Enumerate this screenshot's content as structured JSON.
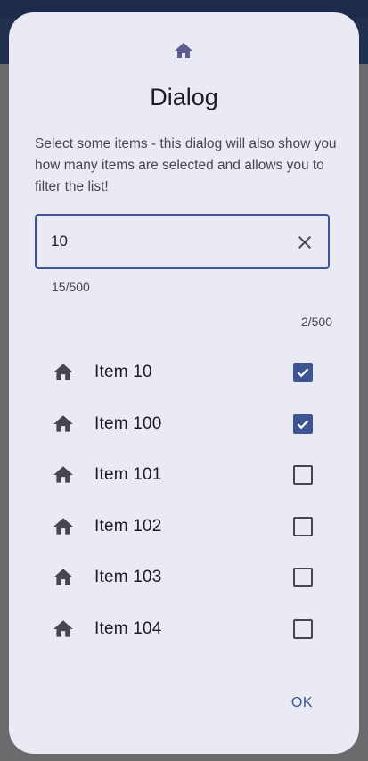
{
  "dialog": {
    "icon": "home-icon",
    "title": "Dialog",
    "description": "Select some items - this dialog will also show you how many items are selected and allows you to filter the list!",
    "search": {
      "value": "10",
      "clear_icon": "close-icon",
      "char_counter": "15/500"
    },
    "selected_counter": "2/500",
    "items": [
      {
        "label": "Item 10",
        "icon": "home-icon",
        "checked": true
      },
      {
        "label": "Item 100",
        "icon": "home-icon",
        "checked": true
      },
      {
        "label": "Item 101",
        "icon": "home-icon",
        "checked": false
      },
      {
        "label": "Item 102",
        "icon": "home-icon",
        "checked": false
      },
      {
        "label": "Item 103",
        "icon": "home-icon",
        "checked": false
      },
      {
        "label": "Item 104",
        "icon": "home-icon",
        "checked": false
      }
    ],
    "ok_label": "OK"
  },
  "colors": {
    "accent": "#3d5593",
    "dialog_background": "#eaeaf4",
    "scrim": "#6f6f72",
    "header_icon": "#5a5f8f"
  }
}
